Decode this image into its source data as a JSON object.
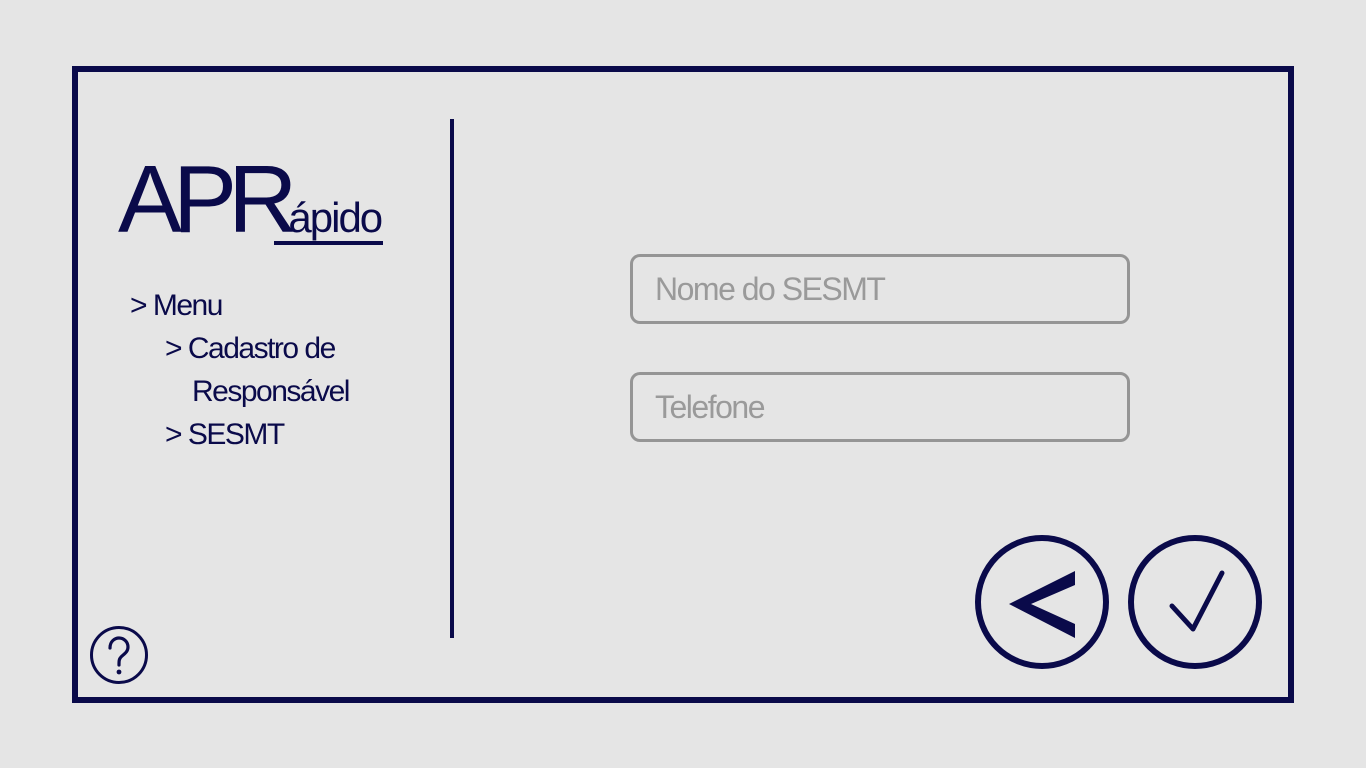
{
  "logo": {
    "main": "APR",
    "sub": "ápido"
  },
  "menu": {
    "root": "> Menu",
    "cadastro_line1": "> Cadastro de",
    "cadastro_line2": "Responsável",
    "sesmt": "> SESMT"
  },
  "form": {
    "nome_placeholder": "Nome do SESMT",
    "nome_value": "",
    "telefone_placeholder": "Telefone",
    "telefone_value": ""
  },
  "buttons": {
    "back_icon": "chevron-left-icon",
    "confirm_icon": "checkmark-icon",
    "help_icon": "question-mark-icon"
  },
  "colors": {
    "primary": "#0a0a4a",
    "background": "#e5e5e5",
    "field_border": "#959595",
    "placeholder": "#9a9a9a"
  }
}
